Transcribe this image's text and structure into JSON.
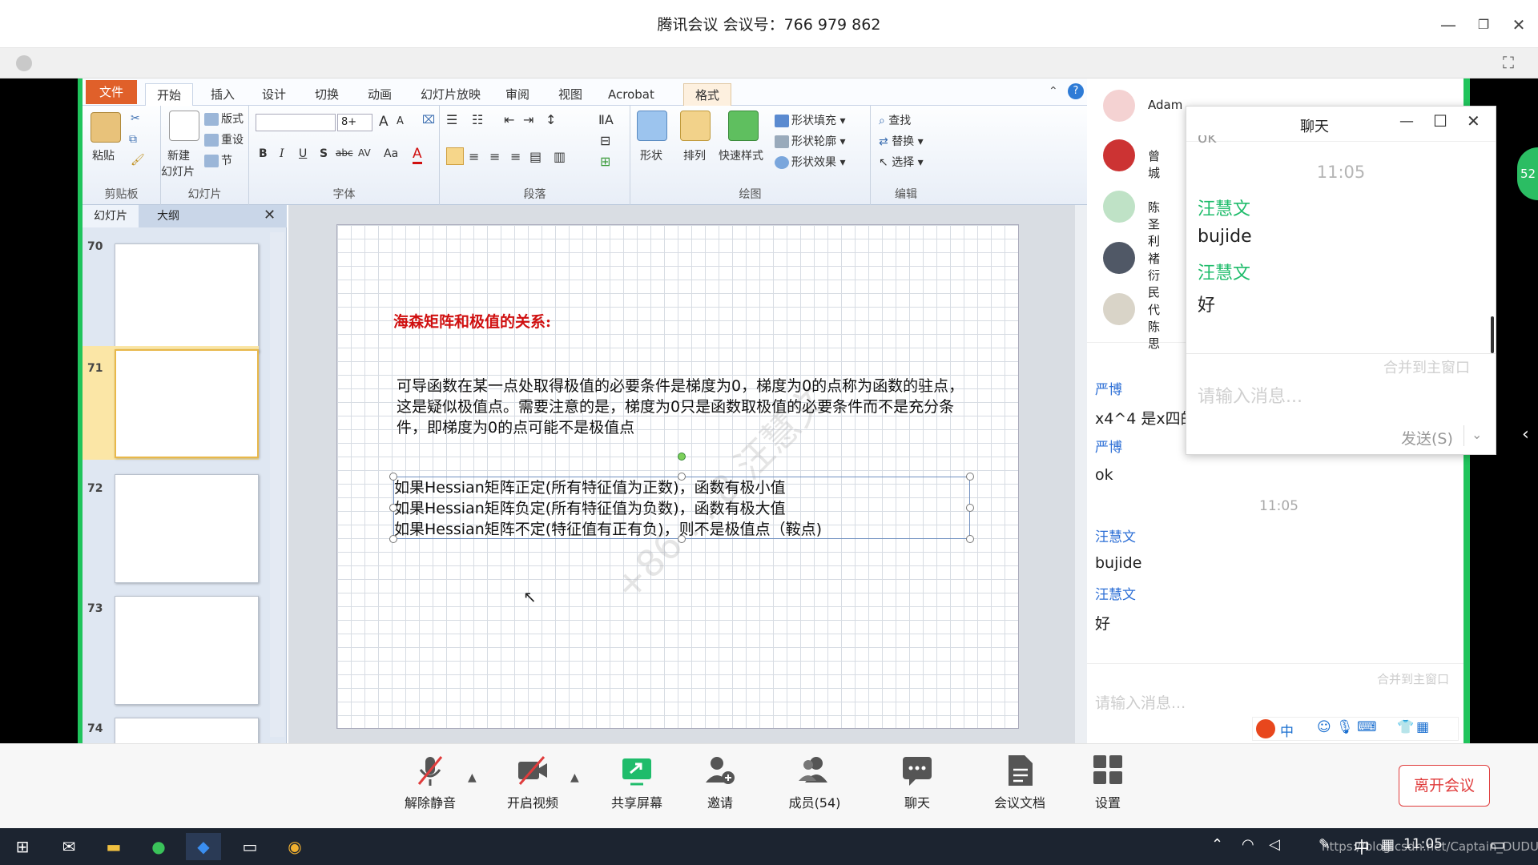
{
  "app": {
    "title": "腾讯会议 会议号：766 979 862"
  },
  "ppt": {
    "tabs": [
      "文件",
      "开始",
      "插入",
      "设计",
      "切换",
      "动画",
      "幻灯片放映",
      "审阅",
      "视图",
      "Acrobat",
      "格式"
    ],
    "clipboard": {
      "paste": "粘贴",
      "label": "剪贴板"
    },
    "slides_group": {
      "new": "新建",
      "new2": "幻灯片",
      "layout": "版式",
      "reset": "重设",
      "section": "节",
      "label": "幻灯片"
    },
    "font_group": {
      "size": "8+",
      "label": "字体",
      "bold": "B",
      "italic": "I",
      "underline": "U",
      "shadow": "S",
      "strike": "abc",
      "spacing": "AV",
      "case": "Aa",
      "fontcolor": "A",
      "grow": "A",
      "shrink": "A"
    },
    "para_group": {
      "label": "段落"
    },
    "draw_group": {
      "shape": "形状",
      "arrange": "排列",
      "quick": "快速样式",
      "fill": "形状填充",
      "outline": "形状轮廓",
      "effect": "形状效果",
      "label": "绘图"
    },
    "edit_group": {
      "find": "查找",
      "replace": "替换",
      "select": "选择",
      "label": "编辑"
    },
    "pane_tabs": [
      "幻灯片",
      "大纲"
    ],
    "slide_numbers": [
      "70",
      "71",
      "72",
      "73",
      "74"
    ],
    "slide": {
      "title": "海森矩阵和极值的关系:",
      "para": "可导函数在某一点处取得极值的必要条件是梯度为0，梯度为0的点称为函数的驻点，这是疑似极值点。需要注意的是，梯度为0只是函数取极值的必要条件而不是充分条件，即梯度为0的点可能不是极值点",
      "lines": [
        "如果Hessian矩阵正定(所有特征值为正数)，函数有极小值",
        "如果Hessian矩阵负定(所有特征值为负数)，函数有极大值",
        "如果Hessian矩阵不定(特征值有正有负)，则不是极值点（鞍点)"
      ],
      "watermark": "+86 ... 8 汪慧文"
    }
  },
  "members": [
    {
      "name": "Adam"
    },
    {
      "name": "曾城"
    },
    {
      "name": "陈圣利"
    },
    {
      "name": "褚衍民"
    },
    {
      "name": "代陈思"
    }
  ],
  "bg_chat": {
    "messages": [
      {
        "name": "严博",
        "text": "x4^4 是x四的"
      },
      {
        "name": "严博",
        "text": "ok"
      },
      {
        "time": "11:05"
      },
      {
        "name": "汪慧文",
        "text": "bujide"
      },
      {
        "name": "汪慧文",
        "text": "好"
      }
    ],
    "merge": "合并到主窗口",
    "placeholder": "请输入消息..."
  },
  "chat_window": {
    "title": "聊天",
    "top_partial": "ok",
    "time": "11:05",
    "messages": [
      {
        "name": "汪慧文",
        "text": "bujide"
      },
      {
        "name": "汪慧文",
        "text": "好"
      }
    ],
    "merge": "合并到主窗口",
    "placeholder": "请输入消息...",
    "send": "发送(S)"
  },
  "toolbar": {
    "mute": "解除静音",
    "video": "开启视频",
    "share": "共享屏幕",
    "invite": "邀请",
    "members": "成员(54)",
    "chat": "聊天",
    "docs": "会议文档",
    "settings": "设置",
    "leave": "离开会议"
  },
  "side_badge": "52",
  "taskbar": {
    "ime": "中",
    "time": "11:05",
    "url": "https://blog.csdn.net/Captain_DUDU"
  },
  "ime_bar": {
    "label": "中"
  }
}
